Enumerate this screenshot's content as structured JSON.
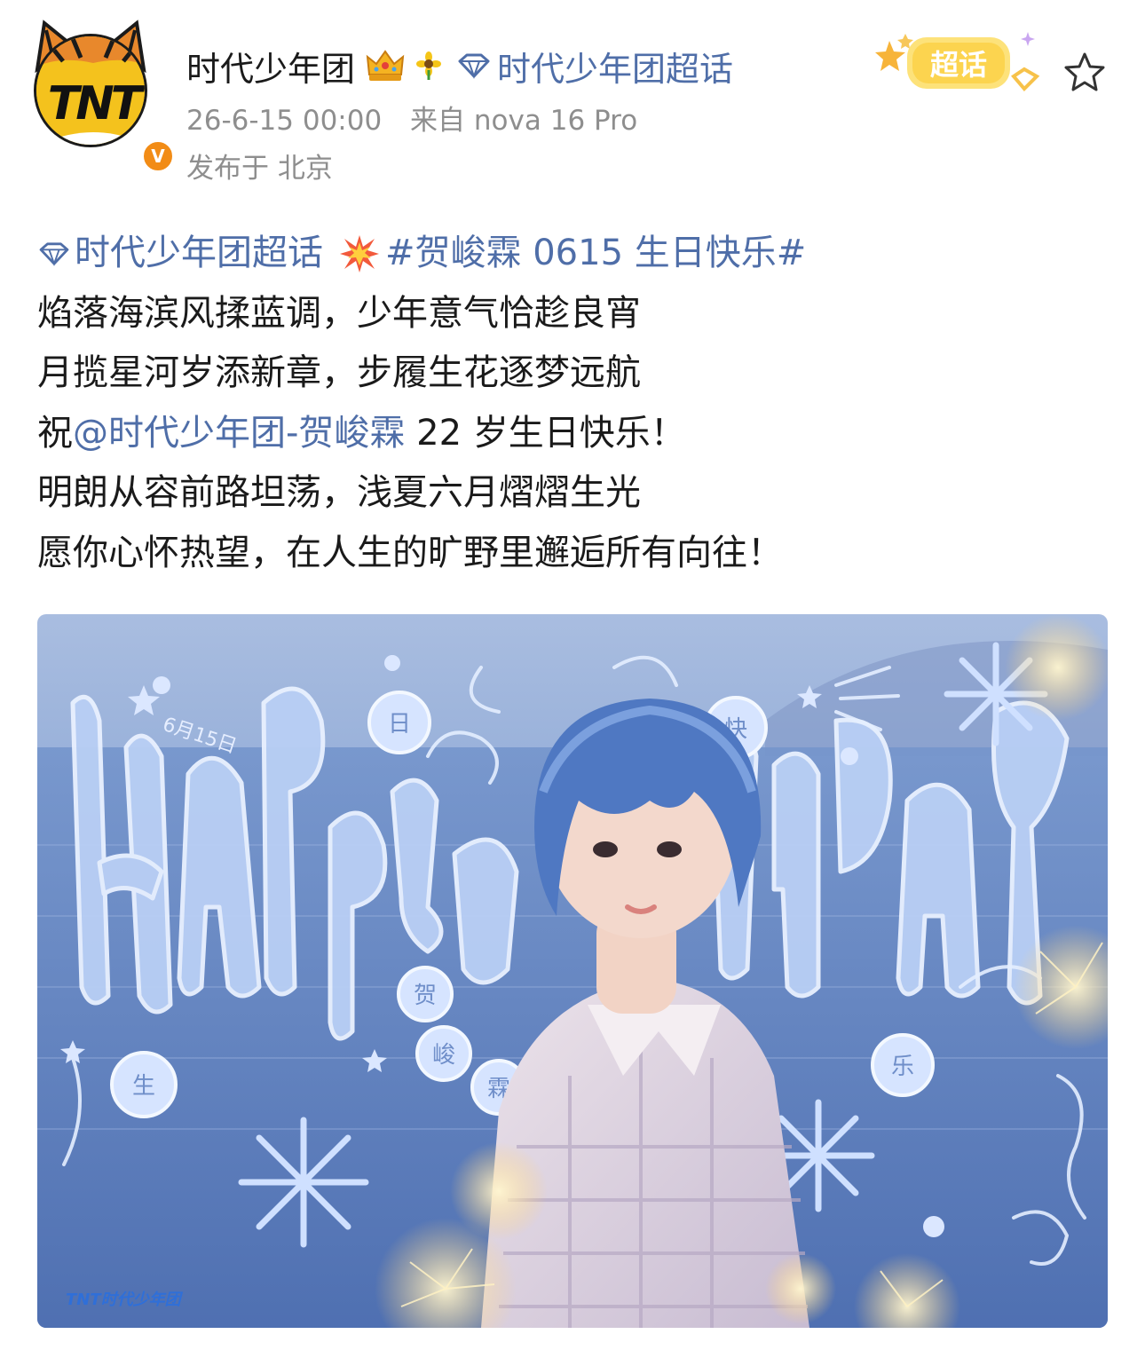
{
  "post": {
    "author": "时代少年团",
    "topic_link": "时代少年团超话",
    "time": "26-6-15 00:00",
    "source_prefix": "来自",
    "source_device": "nova 16 Pro",
    "location": "发布于 北京",
    "supertopic_badge": "超话"
  },
  "content": {
    "topic": "时代少年团超话",
    "hashtag": "#贺峻霖 0615 生日快乐#",
    "line1": "焰落海滨风揉蓝调，少年意气恰趁良宵",
    "line2": "月揽星河岁添新章，步履生花逐梦远航",
    "line3_prefix": "祝",
    "mention": "@时代少年团-贺峻霖",
    "line3_suffix": " 22 岁生日快乐！",
    "line4": "明朗从容前路坦荡，浅夏六月熠熠生光",
    "line5": "愿你心怀热望，在人生的旷野里邂逅所有向往！"
  },
  "image": {
    "date_note": "6月15日",
    "corner_logo": "TNT时代少年团",
    "blessing_chars": [
      "日",
      "快",
      "生",
      "乐",
      "贺",
      "峻",
      "霖"
    ]
  },
  "colors": {
    "link": "#4f6ea8",
    "meta": "#8e8e8e",
    "sky": "#8fa9d6",
    "sea": "#6f8ec9",
    "doodle": "#cfe0ff"
  },
  "icons": [
    "crown-icon",
    "sunflower-icon",
    "diamond-icon",
    "star-icon",
    "explosion-icon",
    "verified-icon"
  ]
}
